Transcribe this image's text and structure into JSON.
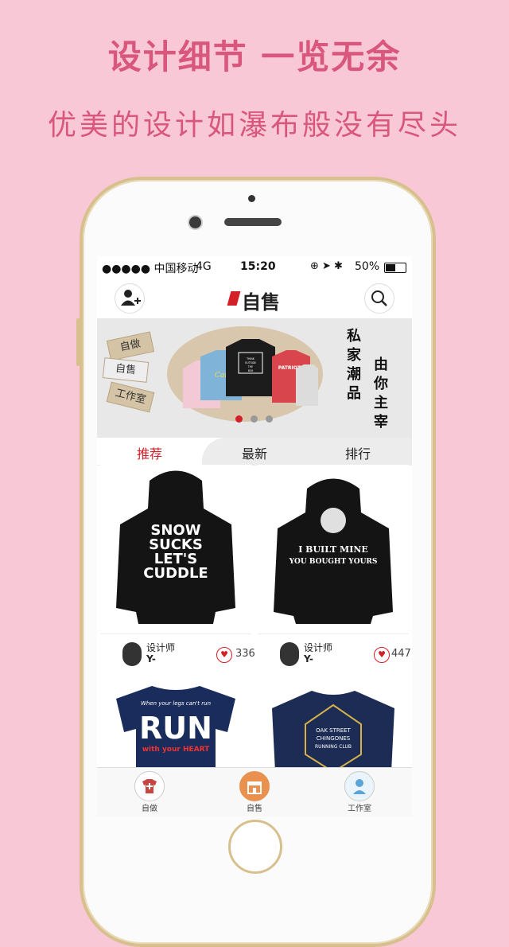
{
  "promo": {
    "headline": "设计细节 一览无余",
    "subline": "优美的设计如瀑布般没有尽头"
  },
  "status_bar": {
    "signal": "●●●●● 中国移动",
    "network": "4G",
    "time": "15:20",
    "battery": "50%"
  },
  "navbar": {
    "logo": "自售",
    "left_icon": "add-user-icon",
    "right_icon": "search-icon"
  },
  "banner": {
    "tags": [
      "自做",
      "自售",
      "工作室"
    ],
    "right_col1": "私家潮品",
    "right_col2": "由你主宰",
    "shirt_text": {
      "box": "THINK OUTSIDE THE BOX",
      "patriots": "PATRIOTS",
      "cares": "Cares"
    },
    "active_dot": 0
  },
  "tabs": [
    {
      "label": "推荐",
      "active": true
    },
    {
      "label": "最新",
      "active": false
    },
    {
      "label": "排行",
      "active": false
    }
  ],
  "products": [
    {
      "design": "SNOW SUCKS LET'S CUDDLE",
      "designer_label": "设计师",
      "designer_id": "Y-",
      "likes": "336"
    },
    {
      "design": "I BUILT MINE YOU BOUGHT YOURS",
      "designer_label": "设计师",
      "designer_id": "Y-",
      "likes": "447"
    },
    {
      "design_top": "When your legs can't run",
      "design_main": "RUN",
      "design_bottom": "with your HEART"
    },
    {
      "design_line1": "OAK STREET",
      "design_line2": "CHINGONES",
      "design_line3": "RUNNING CLUB"
    }
  ],
  "bottom_nav": [
    {
      "label": "自做",
      "icon": "shirt-plus-icon"
    },
    {
      "label": "自售",
      "icon": "shop-icon"
    },
    {
      "label": "工作室",
      "icon": "person-icon"
    }
  ],
  "colors": {
    "background": "#f9c8d6",
    "promo_text": "#d9577c",
    "accent": "#d31f27",
    "phone_frame": "#d8c08e"
  }
}
